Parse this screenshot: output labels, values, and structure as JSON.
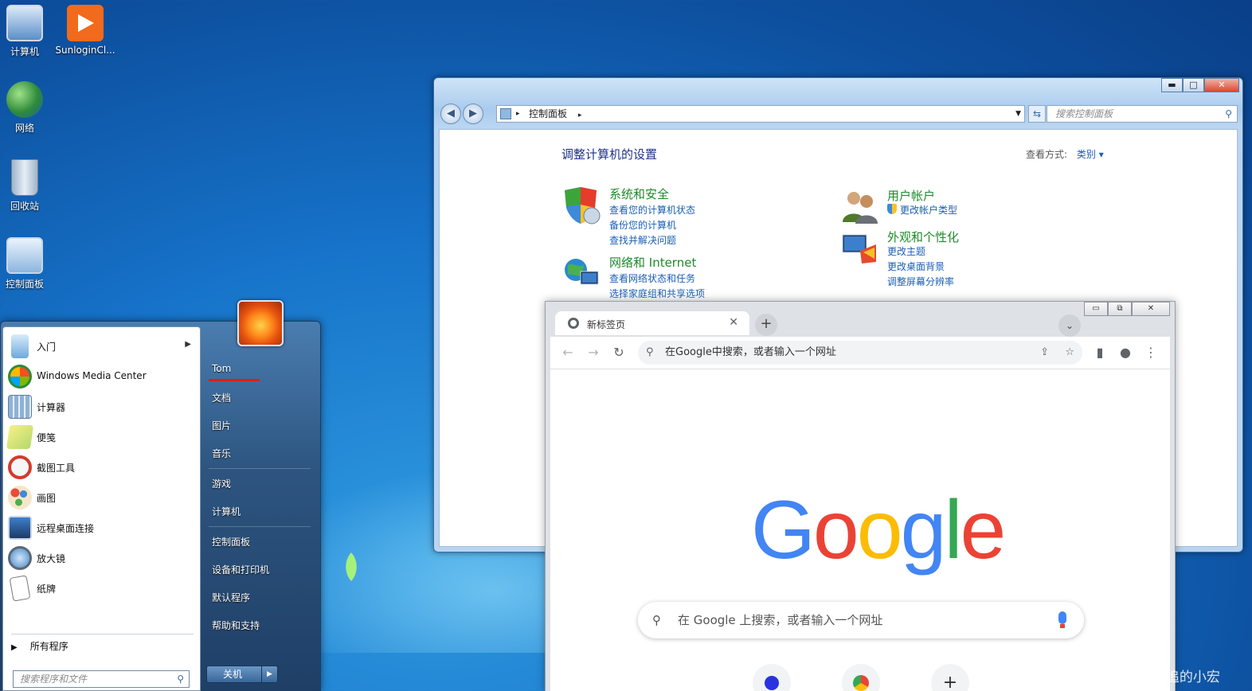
{
  "desktop": {
    "icons": [
      {
        "label": "计算机",
        "icon": "computer-icon"
      },
      {
        "label": "SunloginCl...",
        "icon": "sunlogin-icon"
      },
      {
        "label": "网络",
        "icon": "network-globe-icon"
      },
      {
        "label": "回收站",
        "icon": "recycle-bin-icon"
      },
      {
        "label": "控制面板",
        "icon": "control-panel-icon"
      }
    ]
  },
  "control_panel": {
    "window_buttons": {
      "minimize": "▬",
      "maximize": "□",
      "close": "✕"
    },
    "nav": {
      "back": "◀",
      "forward": "▶"
    },
    "address": {
      "breadcrumb": "控制面板",
      "arrow": "▸"
    },
    "search_placeholder": "搜索控制面板",
    "title": "调整计算机的设置",
    "view_by_label": "查看方式:",
    "view_by_value": "类别 ▾",
    "categories": [
      {
        "title": "系统和安全",
        "icon": "shield-icon",
        "links": [
          "查看您的计算机状态",
          "备份您的计算机",
          "查找并解决问题"
        ]
      },
      {
        "title": "网络和 Internet",
        "icon": "network-icon",
        "links": [
          "查看网络状态和任务",
          "选择家庭组和共享选项"
        ]
      },
      {
        "title": "用户帐户",
        "icon": "users-icon",
        "links": [
          "更改帐户类型"
        ]
      },
      {
        "title": "外观和个性化",
        "icon": "display-icon",
        "links": [
          "更改主题",
          "更改桌面背景",
          "调整屏幕分辨率"
        ]
      }
    ]
  },
  "chrome": {
    "tab_title": "新标签页",
    "tab_close": "✕",
    "new_tab": "+",
    "tab_search": "⌄",
    "window_buttons": {
      "minimize": "▭",
      "restore": "⧉",
      "close": "✕"
    },
    "toolbar": {
      "back": "←",
      "forward": "→",
      "reload": "↻",
      "side_panel": "▮",
      "profile": "●",
      "menu": "⋮"
    },
    "omnibox_placeholder": "在Google中搜索，或者输入一个网址",
    "logo_letters": [
      "G",
      "o",
      "o",
      "g",
      "l",
      "e"
    ],
    "logo_colors": [
      "#4285f4",
      "#ea4335",
      "#fbbc05",
      "#4285f4",
      "#34a853",
      "#ea4335"
    ],
    "page_search_placeholder": "在 Google 上搜索，或者输入一个网址",
    "shortcut_add": "+"
  },
  "start_menu": {
    "programs": [
      {
        "label": "入门",
        "icon": "getting-started-icon",
        "has_submenu": true
      },
      {
        "label": "Windows Media Center",
        "icon": "media-center-icon",
        "has_submenu": false
      },
      {
        "label": "计算器",
        "icon": "calculator-icon",
        "has_submenu": false
      },
      {
        "label": "便笺",
        "icon": "sticky-notes-icon",
        "has_submenu": false
      },
      {
        "label": "截图工具",
        "icon": "snipping-tool-icon",
        "has_submenu": false
      },
      {
        "label": "画图",
        "icon": "paint-icon",
        "has_submenu": false
      },
      {
        "label": "远程桌面连接",
        "icon": "remote-desktop-icon",
        "has_submenu": false
      },
      {
        "label": "放大镜",
        "icon": "magnifier-icon",
        "has_submenu": false
      },
      {
        "label": "纸牌",
        "icon": "solitaire-icon",
        "has_submenu": false
      }
    ],
    "all_programs": "所有程序",
    "search_placeholder": "搜索程序和文件",
    "user_name": "Tom",
    "right_items": [
      "文档",
      "图片",
      "音乐",
      "游戏",
      "计算机",
      "控制面板",
      "设备和打印机",
      "默认程序",
      "帮助和支持"
    ],
    "shutdown_label": "关机"
  },
  "watermark": "CSDN @被代码追的小宏"
}
